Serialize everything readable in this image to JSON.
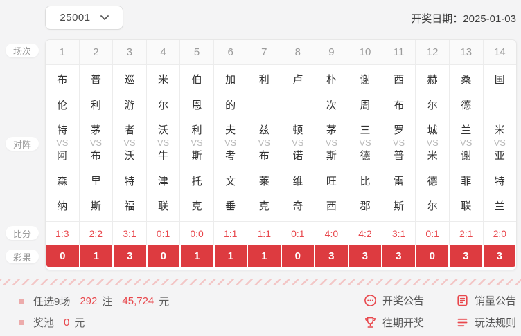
{
  "header": {
    "issue_value": "25001",
    "draw_date_label": "开奖日期：",
    "draw_date_value": "2025-01-03"
  },
  "row_labels": {
    "session": "场次",
    "matchup": "对阵",
    "score": "比分",
    "result": "彩果"
  },
  "vs_label": "VS",
  "matches": [
    {
      "no": "1",
      "home": "布伦特",
      "away": "阿森纳",
      "score": "1:3",
      "result": "0"
    },
    {
      "no": "2",
      "home": "普利茅",
      "away": "布里斯",
      "score": "2:2",
      "result": "1"
    },
    {
      "no": "3",
      "home": "巡游者",
      "away": "沃特福",
      "score": "3:1",
      "result": "3"
    },
    {
      "no": "4",
      "home": "米尔沃",
      "away": "牛津联",
      "score": "0:1",
      "result": "0"
    },
    {
      "no": "5",
      "home": "伯恩利",
      "away": "斯托克",
      "score": "0:0",
      "result": "1"
    },
    {
      "no": "6",
      "home": "加的夫",
      "away": "考文垂",
      "score": "1:1",
      "result": "1"
    },
    {
      "no": "7",
      "home": "利兹",
      "away": "布莱克",
      "score": "1:1",
      "result": "1"
    },
    {
      "no": "8",
      "home": "卢顿",
      "away": "诺维奇",
      "score": "0:1",
      "result": "0"
    },
    {
      "no": "9",
      "home": "朴次茅",
      "away": "斯旺西",
      "score": "4:0",
      "result": "3"
    },
    {
      "no": "10",
      "home": "谢周三",
      "away": "德比郡",
      "score": "4:2",
      "result": "3"
    },
    {
      "no": "11",
      "home": "西布罗",
      "away": "普雷斯",
      "score": "3:1",
      "result": "3"
    },
    {
      "no": "12",
      "home": "赫尔城",
      "away": "米德尔",
      "score": "0:1",
      "result": "0"
    },
    {
      "no": "13",
      "home": "桑德兰",
      "away": "谢菲联",
      "score": "2:1",
      "result": "3"
    },
    {
      "no": "14",
      "home": "国米",
      "away": "亚特兰",
      "score": "2:0",
      "result": "3"
    }
  ],
  "footer": {
    "sales": {
      "label": "任选9场",
      "count": "292",
      "count_unit": "注",
      "amount": "45,724",
      "amount_unit": "元"
    },
    "pool": {
      "label": "奖池",
      "amount": "0",
      "unit": "元"
    },
    "links": [
      {
        "icon": "bubble-dots-icon",
        "label": "开奖公告"
      },
      {
        "icon": "document-icon",
        "label": "销量公告"
      },
      {
        "icon": "trophy-icon",
        "label": "往期开奖"
      },
      {
        "icon": "menu-lines-icon",
        "label": "玩法规则"
      }
    ]
  },
  "colors": {
    "accent_red": "#dd3b40",
    "score_red": "#e8474c"
  }
}
